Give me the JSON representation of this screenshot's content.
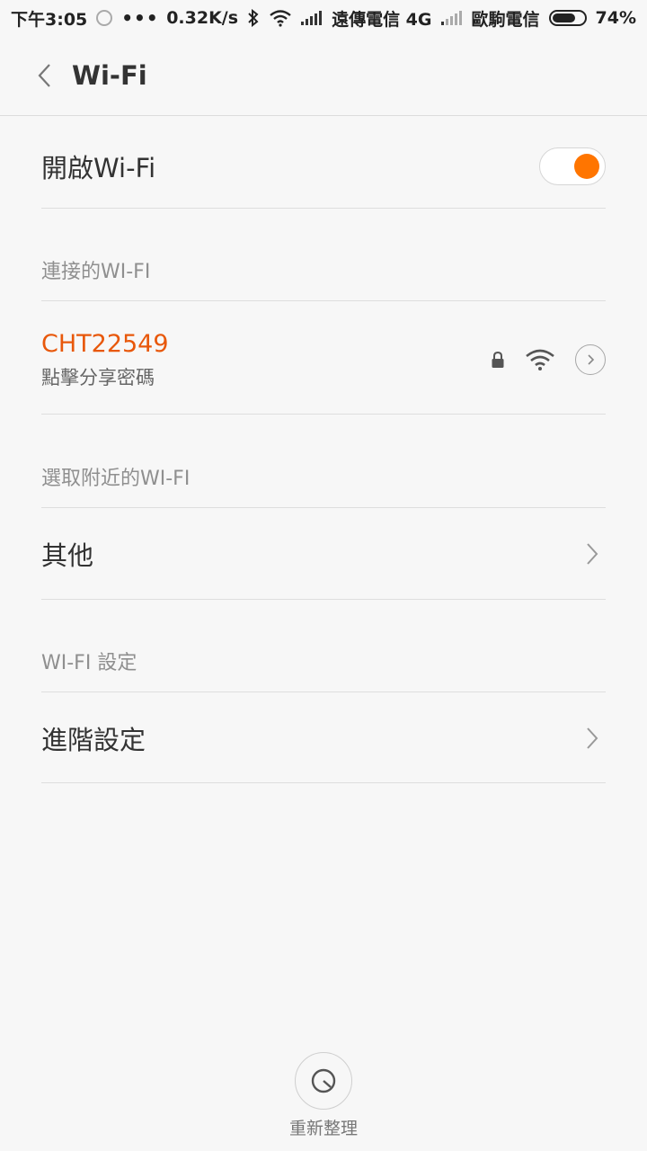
{
  "status_bar": {
    "time": "下午3:05",
    "dots": "•••",
    "speed": "0.32K/s",
    "carrier1": "遠傳電信 4G",
    "carrier2": "歐駒電信",
    "battery": "74%",
    "battery_level": 0.74
  },
  "header": {
    "title": "Wi-Fi"
  },
  "wifi_toggle": {
    "label": "開啟Wi-Fi",
    "on": true
  },
  "connected": {
    "section_label": "連接的WI-FI",
    "network_name": "CHT22549",
    "network_sub": "點擊分享密碼"
  },
  "nearby": {
    "section_label": "選取附近的WI-FI",
    "other_label": "其他"
  },
  "settings": {
    "section_label": "WI-FI 設定",
    "advanced_label": "進階設定"
  },
  "refresh": {
    "label": "重新整理"
  },
  "colors": {
    "accent": "#ff7500",
    "network_name": "#e8580b"
  }
}
